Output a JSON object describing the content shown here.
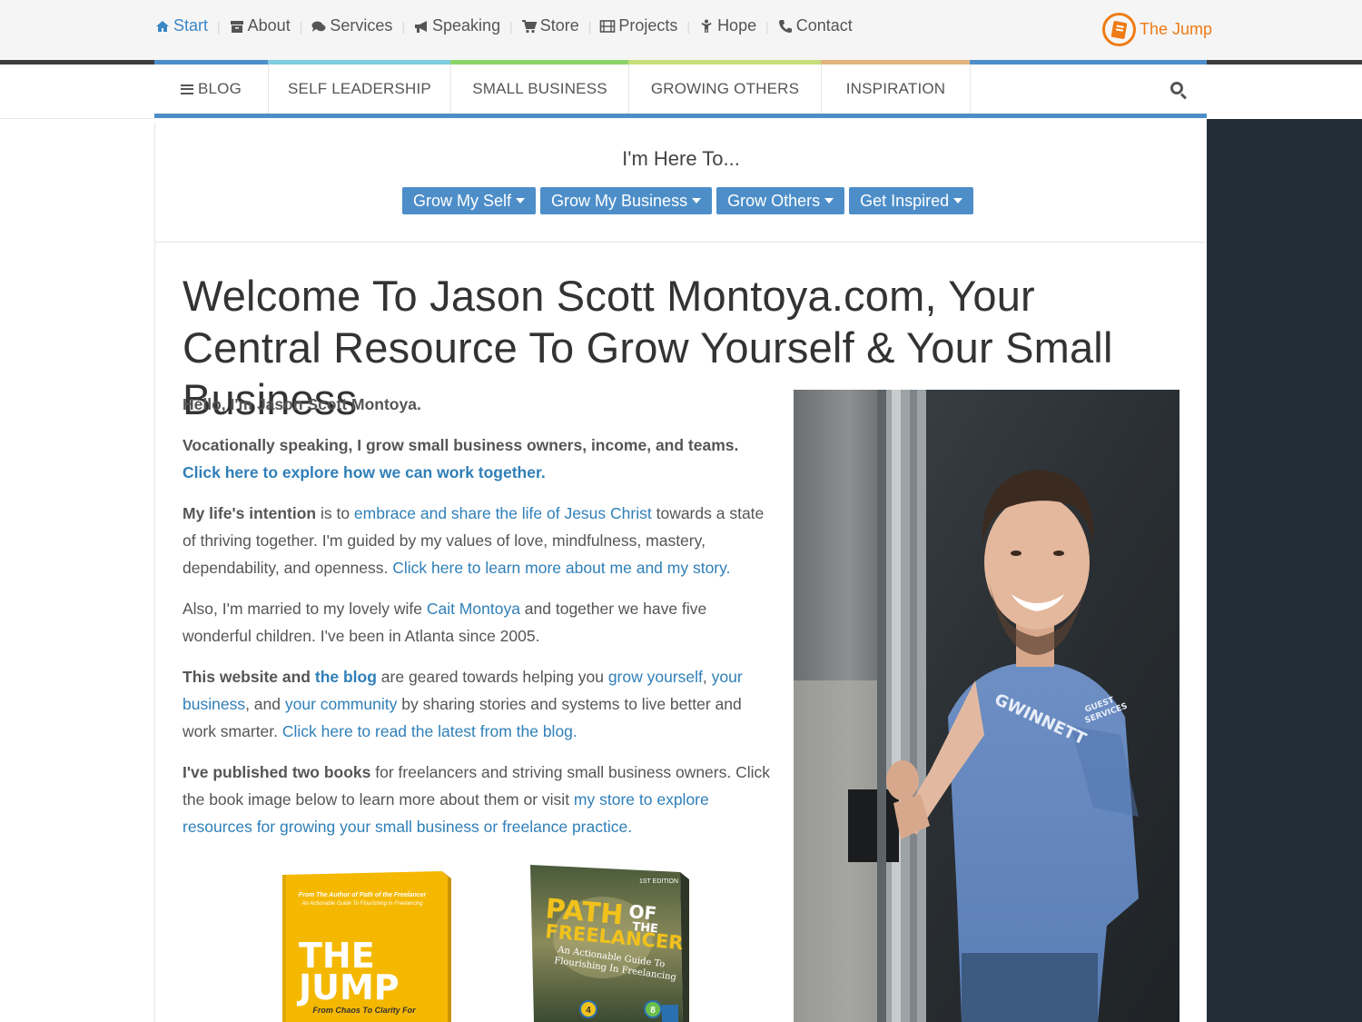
{
  "top_nav": {
    "items": [
      {
        "label": "Start",
        "icon": "home-icon",
        "active": true
      },
      {
        "label": "About",
        "icon": "archive-icon"
      },
      {
        "label": "Services",
        "icon": "comments-icon"
      },
      {
        "label": "Speaking",
        "icon": "bullhorn-icon"
      },
      {
        "label": "Store",
        "icon": "cart-icon"
      },
      {
        "label": "Projects",
        "icon": "film-icon"
      },
      {
        "label": "Hope",
        "icon": "child-icon"
      },
      {
        "label": "Contact",
        "icon": "phone-icon"
      }
    ],
    "jump_label": "The Jump"
  },
  "main_nav": {
    "categories": [
      "BLOG",
      "SELF LEADERSHIP",
      "SMALL BUSINESS",
      "GROWING OTHERS",
      "INSPIRATION"
    ]
  },
  "here_to": {
    "title": "I'm Here To...",
    "buttons": [
      "Grow My Self",
      "Grow My Business",
      "Grow Others",
      "Get Inspired"
    ]
  },
  "headline": "Welcome To Jason Scott Montoya.com, Your Central Resource To Grow Yourself & Your Small Business",
  "intro": {
    "p1": "Hello, I'm Jason Scott Montoya.",
    "p2_text": "Vocationally speaking, I grow small business owners, income, and teams. ",
    "p2_link": "Click here to explore how we can work together.",
    "p3_bold": "My life's intention",
    "p3_a": " is to ",
    "p3_link1": "embrace and share the life of Jesus Christ",
    "p3_b": " towards a state of thriving together. I'm guided by my values of love, mindfulness, mastery, dependability, and openness. ",
    "p3_link2": "Click here to learn more about me and my story.",
    "p4_a": "Also, I'm married to my lovely wife ",
    "p4_link": "Cait Montoya",
    "p4_b": " and together we have five wonderful children. I've been in Atlanta since 2005.",
    "p5_bold": "This website and ",
    "p5_link1": "the blog",
    "p5_a": " are geared towards helping you ",
    "p5_link2": "grow yourself",
    "p5_comma": ", ",
    "p5_link3": "your business",
    "p5_b": ", and ",
    "p5_link4": "your community",
    "p5_c": " by sharing stories and systems to live better and work smarter. ",
    "p5_link5": "Click here to read the latest from the blog.",
    "p6_bold": "I've published two books",
    "p6_a": " for freelancers and striving small business owners. Click the book image below to learn more about them or visit ",
    "p6_link": "my store to explore resources for growing your small business or freelance practice."
  },
  "books": {
    "jump": {
      "top_line1": "From The Author of Path of the Freelancer",
      "top_line2": "An Actionable Guide To Flourishing In Freelancing",
      "title1": "THE",
      "title2": "JUMP",
      "subtitle": "From Chaos To Clarity For"
    },
    "path": {
      "edition": "1ST EDITION",
      "title1": "PATH",
      "title2": "OF",
      "title3": "THE",
      "title4": "FREELANCER",
      "sub1": "An Actionable Guide To",
      "sub2": "Flourishing In Freelancing",
      "badge1": "4",
      "badge2": "8"
    }
  },
  "photo": {
    "shirt_text1": "GWINNETT",
    "shirt_text2": "GUEST",
    "shirt_text3": "SERVICES"
  },
  "colors": {
    "accent_blue": "#4d8ec9",
    "link_blue": "#2f7fb8",
    "orange": "#ef7b14",
    "dark_panel": "#222e36",
    "strip": [
      "#4d8ec9",
      "#7fcbe0",
      "#8cd46a",
      "#c6de7a",
      "#e2b37c",
      "#4d8ec9"
    ]
  }
}
